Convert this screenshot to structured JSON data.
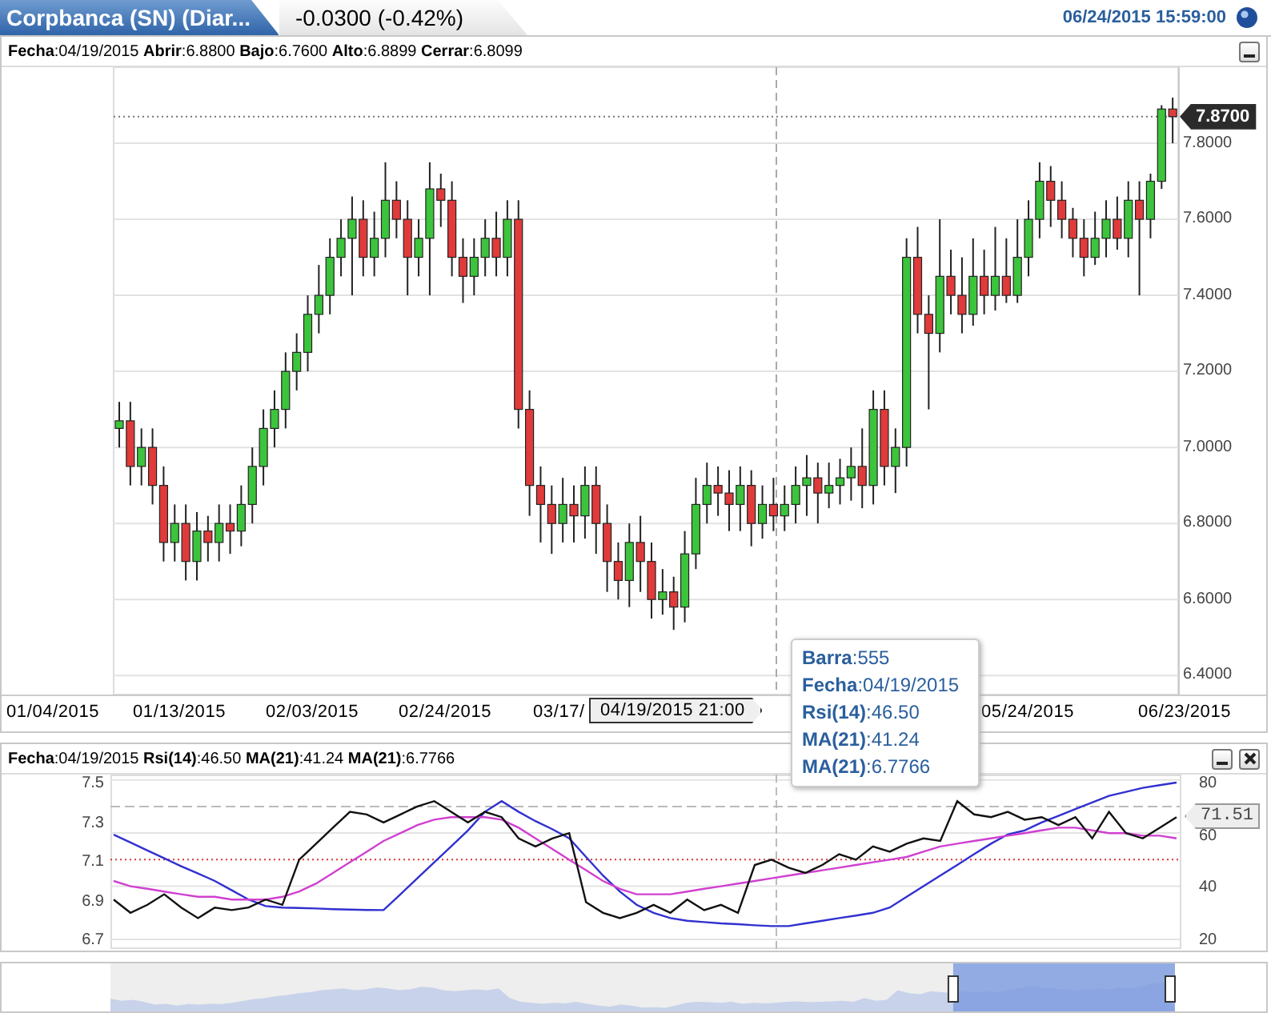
{
  "header": {
    "title": "Corpbanca (SN) (Diar...",
    "change": "-0.0300 (-0.42%)",
    "datetime": "06/24/2015 15:59:00"
  },
  "price_panel": {
    "info": "**Fecha**:04/19/2015 **Abrir**:6.8800 **Bajo**:6.7600 **Alto**:6.8899 **Cerrar**:6.8099",
    "last_price": "7.8700",
    "x_ticks": [
      "01/04/2015",
      "01/13/2015",
      "02/03/2015",
      "02/24/2015",
      "03/17/",
      "05/24/2015",
      "06/23/2015"
    ],
    "crosshair_label": "04/19/2015 21:00",
    "chart_data": {
      "type": "candlestick",
      "ylim": [
        6.35,
        8.0
      ],
      "grid": true,
      "ref_lines": [
        {
          "axis": "y",
          "value": 7.87,
          "color": "#777777"
        }
      ],
      "yticks": [
        {
          "value": 7.8,
          "label": "7.8000"
        },
        {
          "value": 7.6,
          "label": "7.6000"
        },
        {
          "value": 7.4,
          "label": "7.4000"
        },
        {
          "value": 7.2,
          "label": "7.2000"
        },
        {
          "value": 7.0,
          "label": "7.0000"
        },
        {
          "value": 6.8,
          "label": "6.8000"
        },
        {
          "value": 6.6,
          "label": "6.6000"
        },
        {
          "value": 6.4,
          "label": "6.4000"
        }
      ],
      "ohlc": [
        [
          7.05,
          7.12,
          7.0,
          7.07
        ],
        [
          7.07,
          7.12,
          6.9,
          6.95
        ],
        [
          6.95,
          7.05,
          6.9,
          7.0
        ],
        [
          7.0,
          7.05,
          6.85,
          6.9
        ],
        [
          6.9,
          6.95,
          6.7,
          6.75
        ],
        [
          6.75,
          6.85,
          6.7,
          6.8
        ],
        [
          6.8,
          6.85,
          6.65,
          6.7
        ],
        [
          6.7,
          6.83,
          6.65,
          6.78
        ],
        [
          6.78,
          6.82,
          6.7,
          6.75
        ],
        [
          6.75,
          6.85,
          6.7,
          6.8
        ],
        [
          6.8,
          6.85,
          6.72,
          6.78
        ],
        [
          6.78,
          6.9,
          6.74,
          6.85
        ],
        [
          6.85,
          7.0,
          6.8,
          6.95
        ],
        [
          6.95,
          7.1,
          6.9,
          7.05
        ],
        [
          7.05,
          7.15,
          7.0,
          7.1
        ],
        [
          7.1,
          7.25,
          7.05,
          7.2
        ],
        [
          7.2,
          7.3,
          7.15,
          7.25
        ],
        [
          7.25,
          7.4,
          7.2,
          7.35
        ],
        [
          7.35,
          7.48,
          7.3,
          7.4
        ],
        [
          7.4,
          7.55,
          7.35,
          7.5
        ],
        [
          7.5,
          7.6,
          7.45,
          7.55
        ],
        [
          7.55,
          7.66,
          7.4,
          7.6
        ],
        [
          7.6,
          7.65,
          7.45,
          7.5
        ],
        [
          7.5,
          7.62,
          7.45,
          7.55
        ],
        [
          7.55,
          7.75,
          7.5,
          7.65
        ],
        [
          7.65,
          7.7,
          7.55,
          7.6
        ],
        [
          7.6,
          7.65,
          7.4,
          7.5
        ],
        [
          7.5,
          7.6,
          7.45,
          7.55
        ],
        [
          7.55,
          7.75,
          7.4,
          7.68
        ],
        [
          7.68,
          7.72,
          7.58,
          7.65
        ],
        [
          7.65,
          7.7,
          7.45,
          7.5
        ],
        [
          7.5,
          7.55,
          7.38,
          7.45
        ],
        [
          7.45,
          7.55,
          7.4,
          7.5
        ],
        [
          7.5,
          7.6,
          7.45,
          7.55
        ],
        [
          7.55,
          7.62,
          7.45,
          7.5
        ],
        [
          7.5,
          7.65,
          7.45,
          7.6
        ],
        [
          7.6,
          7.65,
          7.05,
          7.1
        ],
        [
          7.1,
          7.15,
          6.82,
          6.9
        ],
        [
          6.9,
          6.95,
          6.75,
          6.85
        ],
        [
          6.85,
          6.9,
          6.72,
          6.8
        ],
        [
          6.8,
          6.92,
          6.75,
          6.85
        ],
        [
          6.85,
          6.9,
          6.75,
          6.82
        ],
        [
          6.82,
          6.95,
          6.76,
          6.9
        ],
        [
          6.9,
          6.95,
          6.72,
          6.8
        ],
        [
          6.8,
          6.85,
          6.62,
          6.7
        ],
        [
          6.7,
          6.75,
          6.6,
          6.65
        ],
        [
          6.65,
          6.8,
          6.58,
          6.75
        ],
        [
          6.75,
          6.82,
          6.62,
          6.7
        ],
        [
          6.7,
          6.75,
          6.55,
          6.6
        ],
        [
          6.6,
          6.68,
          6.56,
          6.62
        ],
        [
          6.62,
          6.66,
          6.52,
          6.58
        ],
        [
          6.58,
          6.78,
          6.54,
          6.72
        ],
        [
          6.72,
          6.92,
          6.68,
          6.85
        ],
        [
          6.85,
          6.96,
          6.8,
          6.9
        ],
        [
          6.9,
          6.95,
          6.82,
          6.88
        ],
        [
          6.88,
          6.94,
          6.78,
          6.85
        ],
        [
          6.85,
          6.95,
          6.78,
          6.9
        ],
        [
          6.9,
          6.94,
          6.74,
          6.8
        ],
        [
          6.8,
          6.9,
          6.76,
          6.85
        ],
        [
          6.85,
          6.92,
          6.78,
          6.82
        ],
        [
          6.82,
          6.9,
          6.78,
          6.85
        ],
        [
          6.85,
          6.95,
          6.8,
          6.9
        ],
        [
          6.9,
          6.98,
          6.82,
          6.92
        ],
        [
          6.92,
          6.96,
          6.8,
          6.88
        ],
        [
          6.88,
          6.96,
          6.84,
          6.9
        ],
        [
          6.9,
          6.97,
          6.85,
          6.92
        ],
        [
          6.92,
          7.0,
          6.86,
          6.95
        ],
        [
          6.95,
          7.05,
          6.84,
          6.9
        ],
        [
          6.9,
          7.15,
          6.85,
          7.1
        ],
        [
          7.1,
          7.15,
          6.9,
          6.95
        ],
        [
          6.95,
          7.05,
          6.88,
          7.0
        ],
        [
          7.0,
          7.55,
          6.95,
          7.5
        ],
        [
          7.5,
          7.58,
          7.3,
          7.35
        ],
        [
          7.35,
          7.4,
          7.1,
          7.3
        ],
        [
          7.3,
          7.6,
          7.25,
          7.45
        ],
        [
          7.45,
          7.52,
          7.35,
          7.4
        ],
        [
          7.4,
          7.5,
          7.3,
          7.35
        ],
        [
          7.35,
          7.55,
          7.32,
          7.45
        ],
        [
          7.45,
          7.52,
          7.35,
          7.4
        ],
        [
          7.4,
          7.58,
          7.36,
          7.45
        ],
        [
          7.45,
          7.55,
          7.38,
          7.4
        ],
        [
          7.4,
          7.6,
          7.38,
          7.5
        ],
        [
          7.5,
          7.65,
          7.45,
          7.6
        ],
        [
          7.6,
          7.75,
          7.55,
          7.7
        ],
        [
          7.7,
          7.74,
          7.58,
          7.65
        ],
        [
          7.65,
          7.7,
          7.55,
          7.6
        ],
        [
          7.6,
          7.63,
          7.5,
          7.55
        ],
        [
          7.55,
          7.6,
          7.45,
          7.5
        ],
        [
          7.5,
          7.62,
          7.48,
          7.55
        ],
        [
          7.55,
          7.65,
          7.5,
          7.6
        ],
        [
          7.6,
          7.66,
          7.52,
          7.55
        ],
        [
          7.55,
          7.7,
          7.5,
          7.65
        ],
        [
          7.65,
          7.7,
          7.4,
          7.6
        ],
        [
          7.6,
          7.72,
          7.55,
          7.7
        ],
        [
          7.7,
          7.9,
          7.68,
          7.89
        ],
        [
          7.89,
          7.92,
          7.8,
          7.87
        ]
      ]
    }
  },
  "tooltip": [
    "**Barra**:555",
    "**Fecha**:04/19/2015",
    "**Rsi(14)**:46.50",
    "**MA(21)**:41.24",
    "**MA(21)**:6.7766"
  ],
  "rsi_panel": {
    "info": "**Fecha**:04/19/2015 **Rsi(14)**:46.50 **MA(21)**:41.24 **MA(21)**:6.7766",
    "left_ticks": [
      "7.5",
      "7.3",
      "7.1",
      "6.9",
      "6.7"
    ],
    "last_value": "71.51",
    "chart_data": {
      "type": "line",
      "ylim": [
        17,
        82
      ],
      "yticks": [
        80,
        60,
        40,
        20
      ],
      "grid": true,
      "ref_lines": [
        {
          "axis": "y",
          "value": 70,
          "color": "#bbbbbb"
        },
        {
          "axis": "y",
          "value": 50,
          "color": "#dd3333"
        }
      ],
      "series": [
        {
          "color": "#111111",
          "values": [
            35,
            30,
            33,
            37,
            32,
            28,
            32,
            31,
            32,
            35,
            33,
            50,
            56,
            62,
            68,
            67,
            64,
            67,
            70,
            72,
            68,
            64,
            68,
            66,
            58,
            55,
            58,
            60,
            34,
            30,
            28,
            30,
            33,
            30,
            35,
            31,
            33,
            30,
            48,
            50,
            47,
            45,
            48,
            52,
            50,
            55,
            53,
            56,
            58,
            57,
            72,
            67,
            66,
            68,
            65,
            66,
            63,
            66,
            58,
            68,
            60,
            58,
            62,
            66
          ]
        },
        {
          "color": "#d040d0",
          "values": [
            42,
            40,
            39,
            38,
            37,
            36,
            36,
            35,
            35,
            35,
            36,
            38,
            41,
            45,
            49,
            53,
            57,
            60,
            63,
            65,
            66,
            66,
            66,
            65,
            62,
            58,
            54,
            50,
            46,
            42,
            39,
            37,
            37,
            37,
            38,
            39,
            40,
            41,
            42,
            43,
            44,
            45,
            46,
            47,
            48,
            49,
            50,
            51,
            53,
            55,
            56,
            57,
            58,
            59,
            60,
            61,
            62,
            62,
            61,
            60,
            60,
            59,
            59,
            58
          ]
        },
        {
          "color": "#3030d0",
          "values": [
            59.4,
            56.5,
            53.5,
            50.5,
            47.5,
            44.8,
            42,
            38.5,
            35,
            32.5,
            32,
            31.8,
            31.6,
            31.4,
            31.2,
            31.1,
            31,
            37,
            43,
            49,
            55,
            61,
            68,
            72,
            68,
            64.5,
            61.5,
            58,
            51,
            44,
            38,
            33,
            30,
            28,
            27,
            26.5,
            26,
            25.7,
            25.3,
            25,
            25,
            26,
            27,
            28,
            29,
            30,
            32,
            36,
            40,
            44,
            48,
            52,
            56,
            59.5,
            61,
            64,
            66.5,
            69,
            71.5,
            74,
            75.5,
            77,
            78,
            79
          ]
        }
      ]
    }
  }
}
